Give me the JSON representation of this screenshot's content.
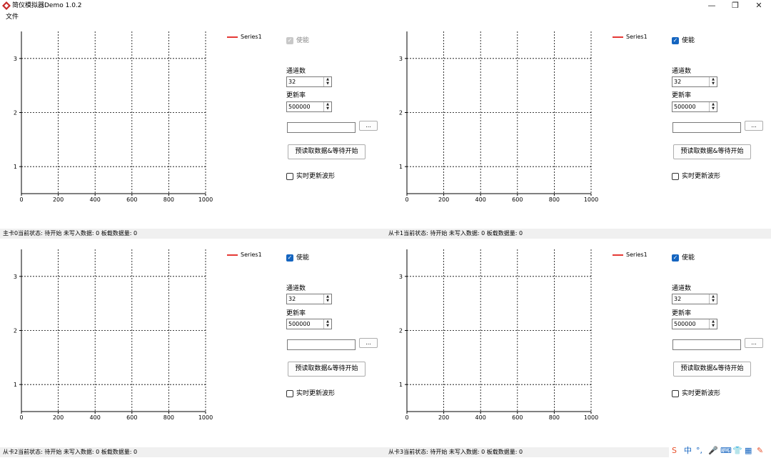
{
  "window": {
    "title": "简仪模拟器Demo 1.0.2",
    "minimize_glyph": "—",
    "restore_glyph": "❐",
    "close_glyph": "✕"
  },
  "menu": {
    "file": "文件"
  },
  "panels": [
    {
      "legend": "Series1",
      "enable": {
        "label": "使能",
        "checked": true,
        "disabled": true
      },
      "channels": {
        "label": "通道数",
        "value": "32"
      },
      "rate": {
        "label": "更新率",
        "value": "500000"
      },
      "path": {
        "value": ""
      },
      "browse_label": "...",
      "start_label": "预读取数据&等待开始",
      "realtime": {
        "label": "实时更新波形",
        "checked": false
      },
      "status": "主卡0当前状态:  待开始   未写入数据:  0   板载数据量:  0"
    },
    {
      "legend": "Series1",
      "enable": {
        "label": "使能",
        "checked": true,
        "disabled": false
      },
      "channels": {
        "label": "通道数",
        "value": "32"
      },
      "rate": {
        "label": "更新率",
        "value": "500000"
      },
      "path": {
        "value": ""
      },
      "browse_label": "...",
      "start_label": "预读取数据&等待开始",
      "realtime": {
        "label": "实时更新波形",
        "checked": false
      },
      "status": "从卡1当前状态:  待开始   未写入数据:  0   板载数据量:  0"
    },
    {
      "legend": "Series1",
      "enable": {
        "label": "使能",
        "checked": true,
        "disabled": false
      },
      "channels": {
        "label": "通道数",
        "value": "32"
      },
      "rate": {
        "label": "更新率",
        "value": "500000"
      },
      "path": {
        "value": ""
      },
      "browse_label": "...",
      "start_label": "预读取数据&等待开始",
      "realtime": {
        "label": "实时更新波形",
        "checked": false
      },
      "status": "从卡2当前状态:  待开始   未写入数据:  0   板载数据量:  0"
    },
    {
      "legend": "Series1",
      "enable": {
        "label": "使能",
        "checked": true,
        "disabled": false
      },
      "channels": {
        "label": "通道数",
        "value": "32"
      },
      "rate": {
        "label": "更新率",
        "value": "500000"
      },
      "path": {
        "value": ""
      },
      "browse_label": "...",
      "start_label": "预读取数据&等待开始",
      "realtime": {
        "label": "实时更新波形",
        "checked": false
      },
      "status": "从卡3当前状态:  待开始   未写入数据:  0   板载数据量:  0"
    }
  ],
  "chart_data": [
    {
      "type": "line",
      "series": [
        {
          "name": "Series1",
          "values": []
        }
      ],
      "x_ticks": [
        0,
        200,
        400,
        600,
        800,
        1000
      ],
      "y_ticks": [
        1,
        2,
        3
      ],
      "xlim": [
        0,
        1000
      ],
      "ylim": [
        0.5,
        3.5
      ],
      "grid": true,
      "legend": "top-right"
    },
    {
      "type": "line",
      "series": [
        {
          "name": "Series1",
          "values": []
        }
      ],
      "x_ticks": [
        0,
        200,
        400,
        600,
        800,
        1000
      ],
      "y_ticks": [
        1,
        2,
        3
      ],
      "xlim": [
        0,
        1000
      ],
      "ylim": [
        0.5,
        3.5
      ],
      "grid": true,
      "legend": "top-right"
    },
    {
      "type": "line",
      "series": [
        {
          "name": "Series1",
          "values": []
        }
      ],
      "x_ticks": [
        0,
        200,
        400,
        600,
        800,
        1000
      ],
      "y_ticks": [
        1,
        2,
        3
      ],
      "xlim": [
        0,
        1000
      ],
      "ylim": [
        0.5,
        3.5
      ],
      "grid": true,
      "legend": "top-right"
    },
    {
      "type": "line",
      "series": [
        {
          "name": "Series1",
          "values": []
        }
      ],
      "x_ticks": [
        0,
        200,
        400,
        600,
        800,
        1000
      ],
      "y_ticks": [
        1,
        2,
        3
      ],
      "xlim": [
        0,
        1000
      ],
      "ylim": [
        0.5,
        3.5
      ],
      "grid": true,
      "legend": "top-right"
    }
  ],
  "colors": {
    "series": "#e53935",
    "accent": "#1565c0",
    "status_bg": "#f0f0f0"
  },
  "tray": [
    {
      "icon": "sogou-ime-icon",
      "glyph": "S",
      "color": "#e8502a"
    },
    {
      "icon": "chinese-mode-icon",
      "glyph": "中",
      "color": "#1565c0"
    },
    {
      "icon": "punctuation-icon",
      "glyph": "°,",
      "color": "#1565c0"
    },
    {
      "icon": "microphone-icon",
      "glyph": "🎤",
      "color": "#1565c0"
    },
    {
      "icon": "keyboard-icon",
      "glyph": "⌨",
      "color": "#1565c0"
    },
    {
      "icon": "skin-icon",
      "glyph": "👕",
      "color": "#1565c0"
    },
    {
      "icon": "apps-icon",
      "glyph": "▦",
      "color": "#1565c0"
    },
    {
      "icon": "tools-icon",
      "glyph": "✎",
      "color": "#e8502a"
    }
  ]
}
